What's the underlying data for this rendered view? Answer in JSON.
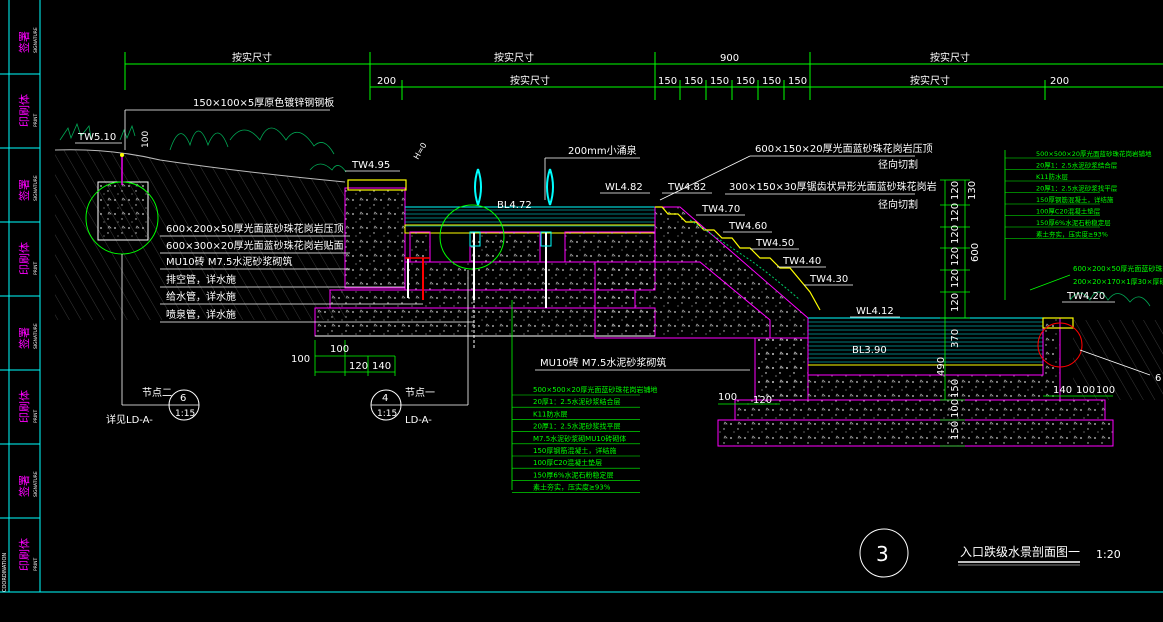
{
  "colors": {
    "background": "#000000",
    "frame": "#00ffff",
    "dimension": "#00ff00",
    "text": "#ffffff",
    "section_pen": "#ff00ff",
    "paving_pen": "#ffff00",
    "pipe_pen": "#ff0000",
    "leader_green": "#00ff00",
    "water": "#00ffff",
    "plants": "#00cc66"
  },
  "sidebar": {
    "cells": [
      {
        "label": "签署",
        "sub": "SIGNATURE"
      },
      {
        "label": "印刷体",
        "sub": "PRINT"
      },
      {
        "label": "签署",
        "sub": "SIGNATURE"
      },
      {
        "label": "印刷体",
        "sub": "PRINT"
      },
      {
        "label": "签署",
        "sub": "SIGNATURE"
      },
      {
        "label": "印刷体",
        "sub": "PRINT"
      },
      {
        "label": "签署",
        "sub": "SIGNATURE"
      },
      {
        "label": "印刷体",
        "sub": "PRINT"
      }
    ],
    "footer": "COORDINATION"
  },
  "dimensions": {
    "top_row": [
      "按实尺寸",
      "按实尺寸",
      "900",
      "按实尺寸"
    ],
    "second_row": [
      "200",
      "按实尺寸",
      "150",
      "150",
      "150",
      "150",
      "150",
      "150",
      "按实尺寸",
      "200"
    ],
    "left_bottom": [
      "100",
      "100",
      "120",
      "140"
    ],
    "right_vertical": [
      "130",
      "120",
      "120",
      "120",
      "120",
      "120",
      "600",
      "120",
      "370",
      "490"
    ],
    "right_bottom_vertical": [
      "150",
      "100",
      "150"
    ],
    "right_bottom_row": [
      "140",
      "100",
      "100"
    ],
    "bottom_left": [
      "100",
      "120"
    ],
    "tw_top": "100"
  },
  "levels": {
    "tw510": "TW5.10",
    "tw495": "TW4.95",
    "bl472": "BL4.72",
    "wl482": "WL4.82",
    "tw482": "TW4.82",
    "tw470": "TW4.70",
    "tw460": "TW4.60",
    "tw450": "TW4.50",
    "tw440": "TW4.40",
    "tw430": "TW4.30",
    "wl412": "WL4.12",
    "bl390": "BL3.90",
    "tw420": "TW4.20"
  },
  "notes": {
    "steel_plate": "150×100×5厚原色镀锌钢钢板",
    "fountain": "200mm小涌泉",
    "coping_a": "600×150×20厚光面蓝砂珠花岗岩压顶",
    "coping_a2": "径向切割",
    "step_stone": "300×150×30厚锯齿状异形光面蓝砂珠花岗岩",
    "step_stone2": "径向切割",
    "left1": "600×200×50厚光面蓝砂珠花岗岩压顶",
    "left2": "600×300×20厚光面蓝砂珠花岗岩贴面",
    "left3": "MU10砖 M7.5水泥砂浆砌筑",
    "left4": "排空管，详水施",
    "left5": "给水管，详水施",
    "left6": "喷泉管，详水施",
    "masonry": "MU10砖 M7.5水泥砂浆砌筑",
    "ha": "H=0",
    "right_stack": [
      "500×500×20厚光面蓝砂珠花岗岩铺地",
      "20厚1：2.5水泥砂浆结合层",
      "K11防水层",
      "20厚1：2.5水泥砂浆找平层",
      "150厚钢筋混凝土，详结施",
      "100厚C20混凝土垫层",
      "150厚6%水泥石粉稳定层",
      "素土夯实，压实度≥93%"
    ],
    "right_cap1": "600×200×50厚光面蓝砂珠花",
    "right_cap2": "200×20×170×1厚30×厚硅石",
    "bottom_stack": [
      "500×500×20厚光面蓝砂珠花岗岩铺地",
      "20厚1：2.5水泥砂浆结合层",
      "K11防水层",
      "20厚1：2.5水泥砂浆找平层",
      "M7.5水泥砂浆砌MU10砖砌体",
      "150厚钢筋混凝土，详结施",
      "100厚C20混凝土垫层",
      "150厚6%水泥石粉稳定层",
      "素土夯实，压实度≥93%"
    ]
  },
  "callouts": {
    "node2_label": "节点二",
    "node2_num": "6",
    "node2_scale": "1:15",
    "node2_ref": "详见LD-A-",
    "node1_label": "节点一",
    "node1_num": "4",
    "node1_scale": "1:15",
    "node1_ref": "LD-A-",
    "right_num": "6"
  },
  "title_block": {
    "number": "3",
    "title": "入口跌级水景剖面图一",
    "scale": "1:20"
  }
}
